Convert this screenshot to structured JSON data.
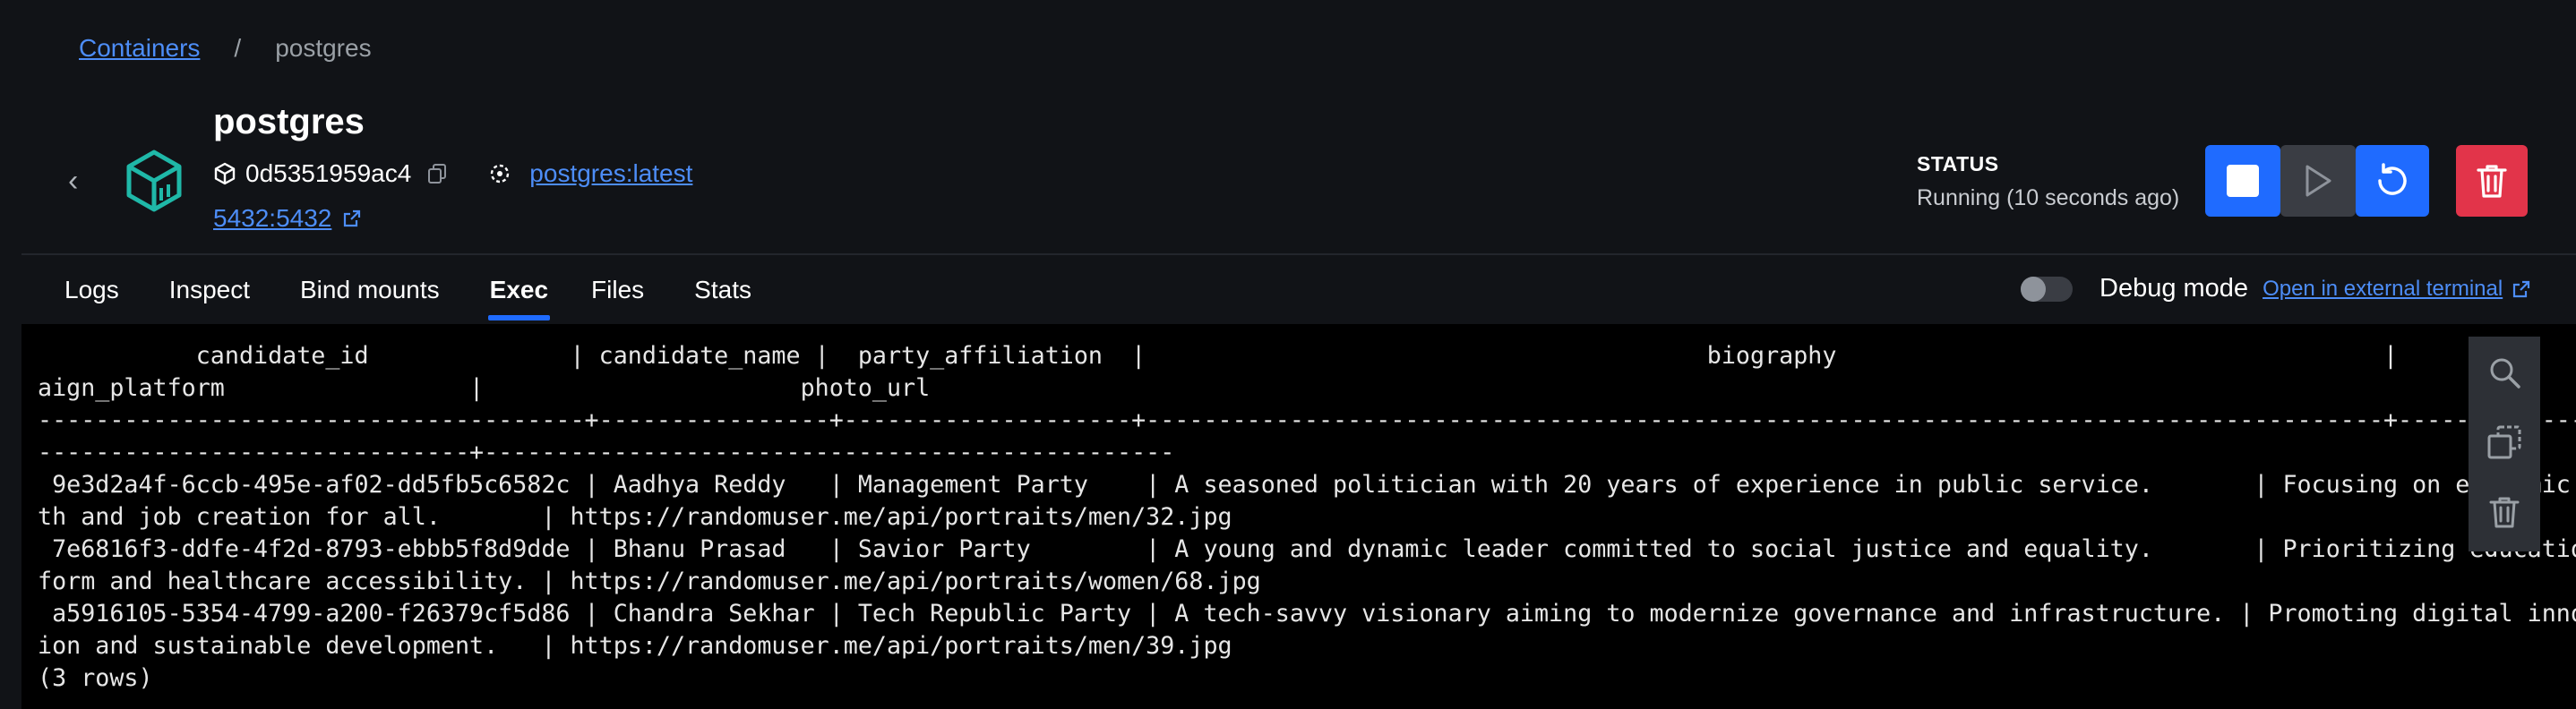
{
  "breadcrumb": {
    "link": "Containers",
    "separator": "/",
    "current": "postgres"
  },
  "container": {
    "name": "postgres",
    "id": "0d5351959ac4",
    "image": "postgres:latest",
    "ports": "5432:5432"
  },
  "status": {
    "label": "STATUS",
    "value": "Running (10 seconds ago)"
  },
  "actions": [
    "stop",
    "start",
    "restart",
    "delete"
  ],
  "tabs": [
    {
      "label": "Logs"
    },
    {
      "label": "Inspect"
    },
    {
      "label": "Bind mounts"
    },
    {
      "label": "Exec",
      "active": true
    },
    {
      "label": "Files"
    },
    {
      "label": "Stats"
    }
  ],
  "debug": {
    "label": "Debug mode",
    "enabled": false,
    "external_link": "Open in external terminal"
  },
  "terminal": {
    "lines": [
      "           candidate_id              | candidate_name |  party_affiliation  |                                       biography                                      |                   camp",
      "aign_platform                 |                      photo_url",
      "--------------------------------------+----------------+--------------------+--------------------------------------------------------------------------------------+-------------------------",
      "------------------------------+------------------------------------------------",
      " 9e3d2a4f-6ccb-495e-af02-dd5fb5c6582c | Aadhya Reddy   | Management Party    | A seasoned politician with 20 years of experience in public service.       | Focusing on economic grow",
      "th and job creation for all.       | https://randomuser.me/api/portraits/men/32.jpg",
      " 7e6816f3-ddfe-4f2d-8793-ebbb5f8d9dde | Bhanu Prasad   | Savior Party        | A young and dynamic leader committed to social justice and equality.       | Prioritizing education re",
      "form and healthcare accessibility. | https://randomuser.me/api/portraits/women/68.jpg",
      " a5916105-5354-4799-a200-f26379cf5d86 | Chandra Sekhar | Tech Republic Party | A tech-savvy visionary aiming to modernize governance and infrastructure. | Promoting digital innovat",
      "ion and sustainable development.   | https://randomuser.me/api/portraits/men/39.jpg",
      "(3 rows)"
    ]
  },
  "terminal_tools": [
    "search-icon",
    "copy-icon",
    "trash-icon"
  ],
  "colors": {
    "accent": "#1f6bff",
    "danger": "#e2344a",
    "link": "#4d8df7",
    "container_icon": "#1fb8a8"
  }
}
